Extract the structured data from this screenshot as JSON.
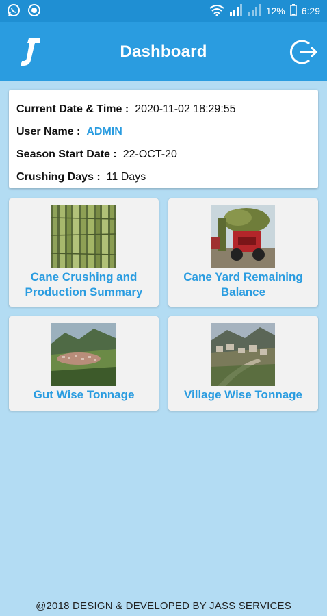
{
  "status_bar": {
    "battery_text": "12%",
    "time": "6:29",
    "icons": [
      "whatsapp-icon",
      "notification-circle-icon",
      "wifi-icon",
      "signal-icon",
      "signal-icon",
      "battery-icon"
    ]
  },
  "header": {
    "title": "Dashboard",
    "logo": "j-logo",
    "logout_icon": "logout-icon",
    "color": "#2a9ce0"
  },
  "info": {
    "datetime_label": "Current Date & Time :",
    "datetime_value": "2020-11-02 18:29:55",
    "user_label": "User Name :",
    "user_value": "ADMIN",
    "season_label": "Season Start Date :",
    "season_value": "22-OCT-20",
    "crushing_label": "Crushing Days :",
    "crushing_value": "11 Days"
  },
  "tiles": [
    {
      "label": "Cane Crushing and Production Summary",
      "image": "sugarcane-photo"
    },
    {
      "label": "Cane Yard Remaining Balance",
      "image": "tractor-cane-photo"
    },
    {
      "label": "Gut Wise Tonnage",
      "image": "village-valley-photo"
    },
    {
      "label": "Village Wise Tonnage",
      "image": "mountain-village-photo"
    }
  ],
  "footer": {
    "text": "@2018 DESIGN & DEVELOPED BY JASS SERVICES"
  },
  "colors": {
    "background": "#b3dcf3",
    "accent": "#2a9ce0",
    "status_bar": "#1f8fd3"
  }
}
